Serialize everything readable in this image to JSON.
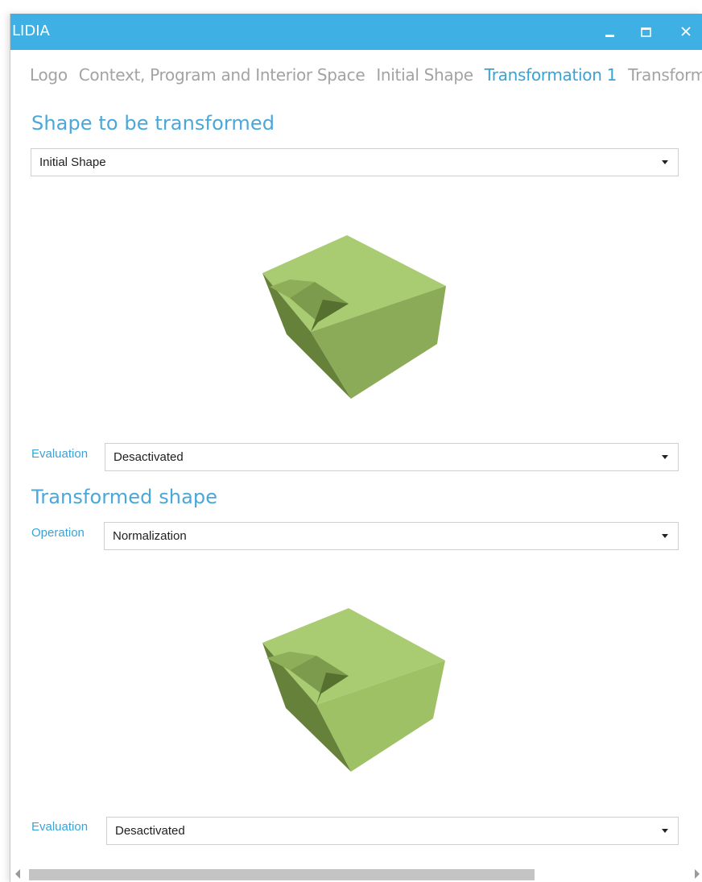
{
  "window": {
    "title": "LIDIA"
  },
  "tabs": [
    {
      "label": "Logo",
      "active": false
    },
    {
      "label": "Context, Program and Interior Space",
      "active": false
    },
    {
      "label": "Initial Shape",
      "active": false
    },
    {
      "label": "Transformation 1",
      "active": true
    },
    {
      "label": "Transform",
      "active": false
    }
  ],
  "section1": {
    "title": "Shape to be transformed",
    "shape_select": {
      "value": "Initial Shape"
    },
    "evaluation": {
      "label": "Evaluation",
      "value": "Desactivated"
    }
  },
  "section2": {
    "title": "Transformed shape",
    "operation": {
      "label": "Operation",
      "value": "Normalization"
    },
    "evaluation": {
      "label": "Evaluation",
      "value": "Desactivated"
    }
  },
  "colors": {
    "titlebar": "#3fb0e3",
    "accent": "#3aa3d6",
    "shape_top": "#a9cc72",
    "shape_side_light": "#8cab58",
    "shape_side_dark": "#66813a"
  },
  "icons": [
    "minimize-icon",
    "maximize-icon",
    "close-icon",
    "dropdown-arrow-icon",
    "scroll-left-icon",
    "scroll-right-icon"
  ]
}
